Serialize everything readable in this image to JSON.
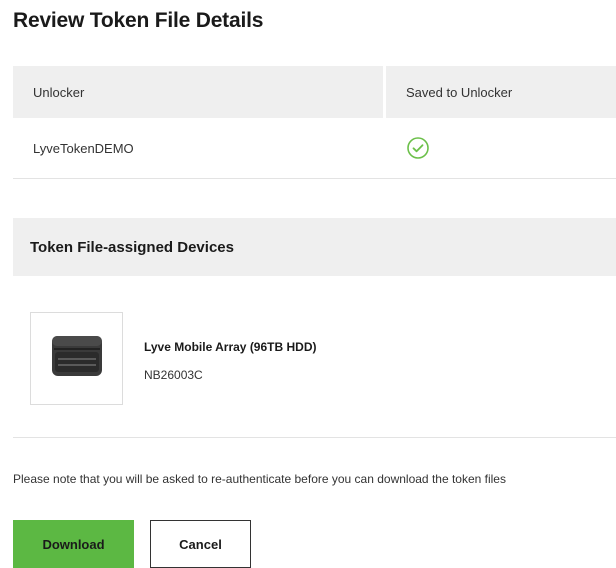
{
  "page": {
    "title": "Review Token File Details"
  },
  "unlocker_table": {
    "columns": [
      "Unlocker",
      "Saved to Unlocker"
    ],
    "rows": [
      {
        "unlocker": "LyveTokenDEMO",
        "saved_icon": "check-circle-icon"
      }
    ]
  },
  "devices": {
    "header": "Token File-assigned Devices",
    "items": [
      {
        "name": "Lyve Mobile Array (96TB HDD)",
        "serial": "NB26003C",
        "icon": "storage-array-icon"
      }
    ]
  },
  "note": "Please note that you will be asked to re-authenticate before you can download the token files",
  "actions": {
    "download_label": "Download",
    "cancel_label": "Cancel"
  },
  "colors": {
    "accent_green": "#5cb843",
    "check_green": "#6cc04a",
    "header_bg": "#efefef"
  }
}
